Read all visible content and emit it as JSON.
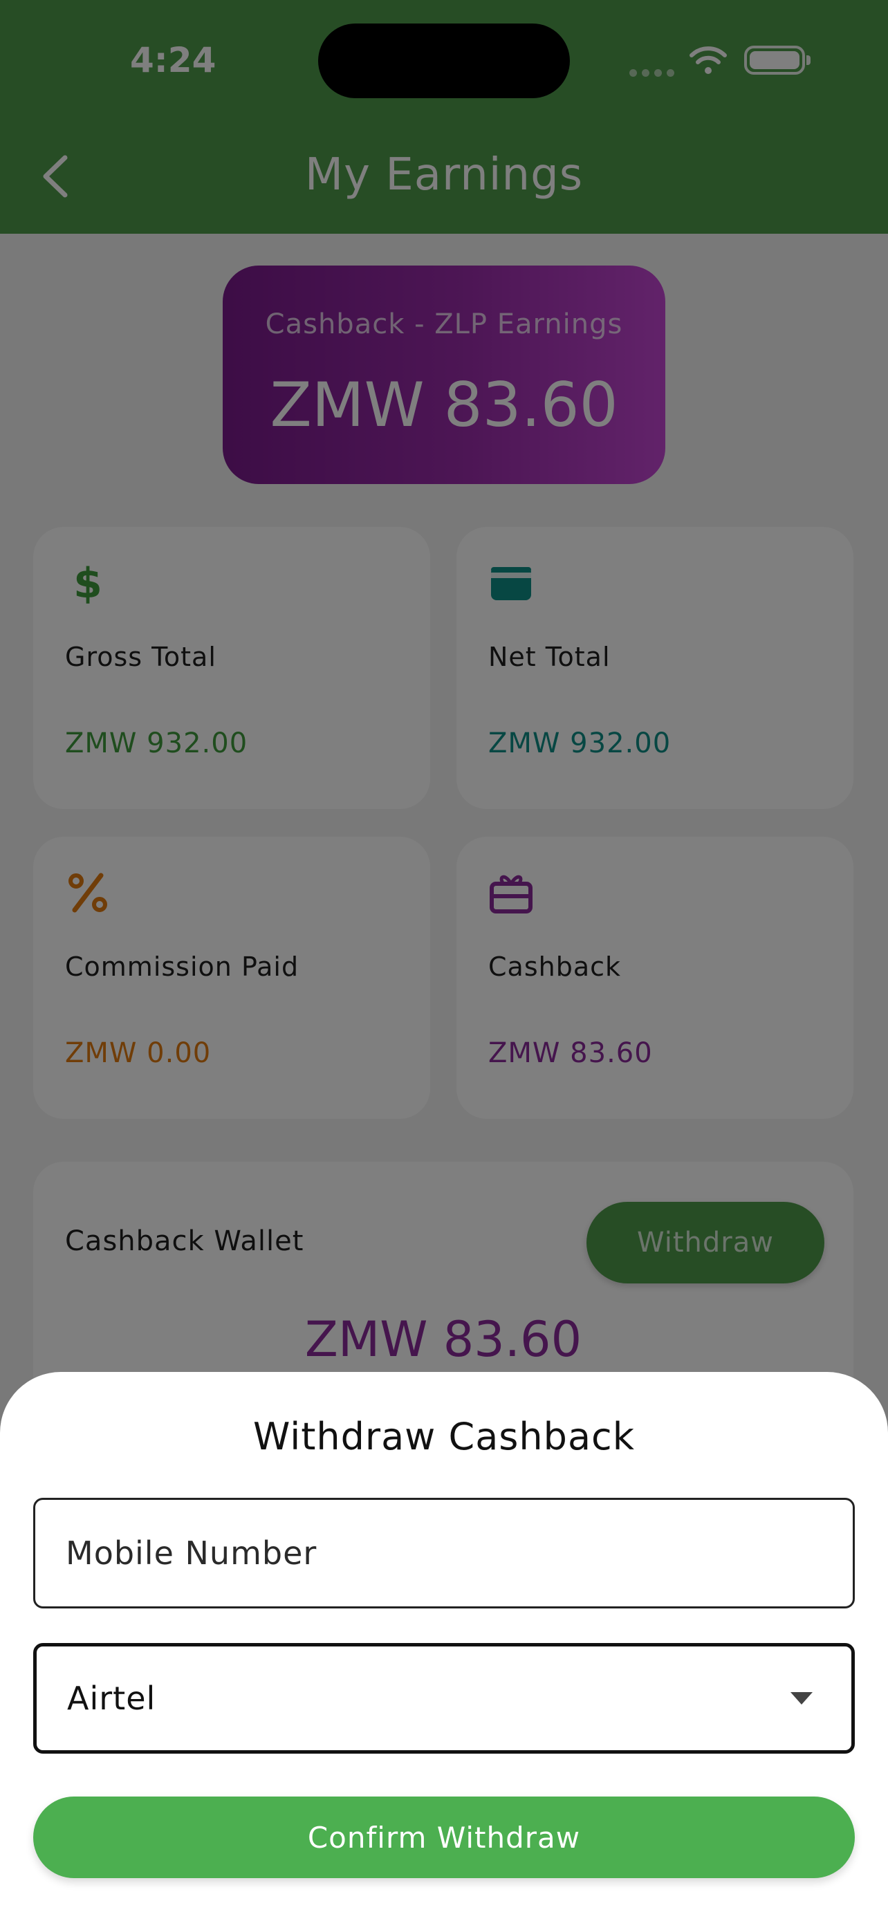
{
  "status_bar": {
    "time": "4:24"
  },
  "header": {
    "title": "My Earnings",
    "back_icon": "chevron-left-icon"
  },
  "hero": {
    "label": "Cashback - ZLP Earnings",
    "value": "ZMW 83.60"
  },
  "cards": [
    {
      "icon": "dollar-icon",
      "label": "Gross Total",
      "value": "ZMW 932.00",
      "color": "#3f9a3c"
    },
    {
      "icon": "wallet-icon",
      "label": "Net Total",
      "value": "ZMW 932.00",
      "color": "#0f8f86"
    },
    {
      "icon": "percent-icon",
      "label": "Commission Paid",
      "value": "ZMW 0.00",
      "color": "#e07a10"
    },
    {
      "icon": "gift-card-icon",
      "label": "Cashback",
      "value": "ZMW 83.60",
      "color": "#8a2a9a"
    }
  ],
  "wallet": {
    "label": "Cashback Wallet",
    "withdraw_label": "Withdraw",
    "value": "ZMW 83.60"
  },
  "sheet": {
    "title": "Withdraw Cashback",
    "mobile_placeholder": "Mobile Number",
    "network_selected": "Airtel",
    "confirm_label": "Confirm Withdraw"
  },
  "colors": {
    "header_green": "#4e9a4b",
    "confirm_green": "#4caf50",
    "purple": "#8a2a9a"
  }
}
